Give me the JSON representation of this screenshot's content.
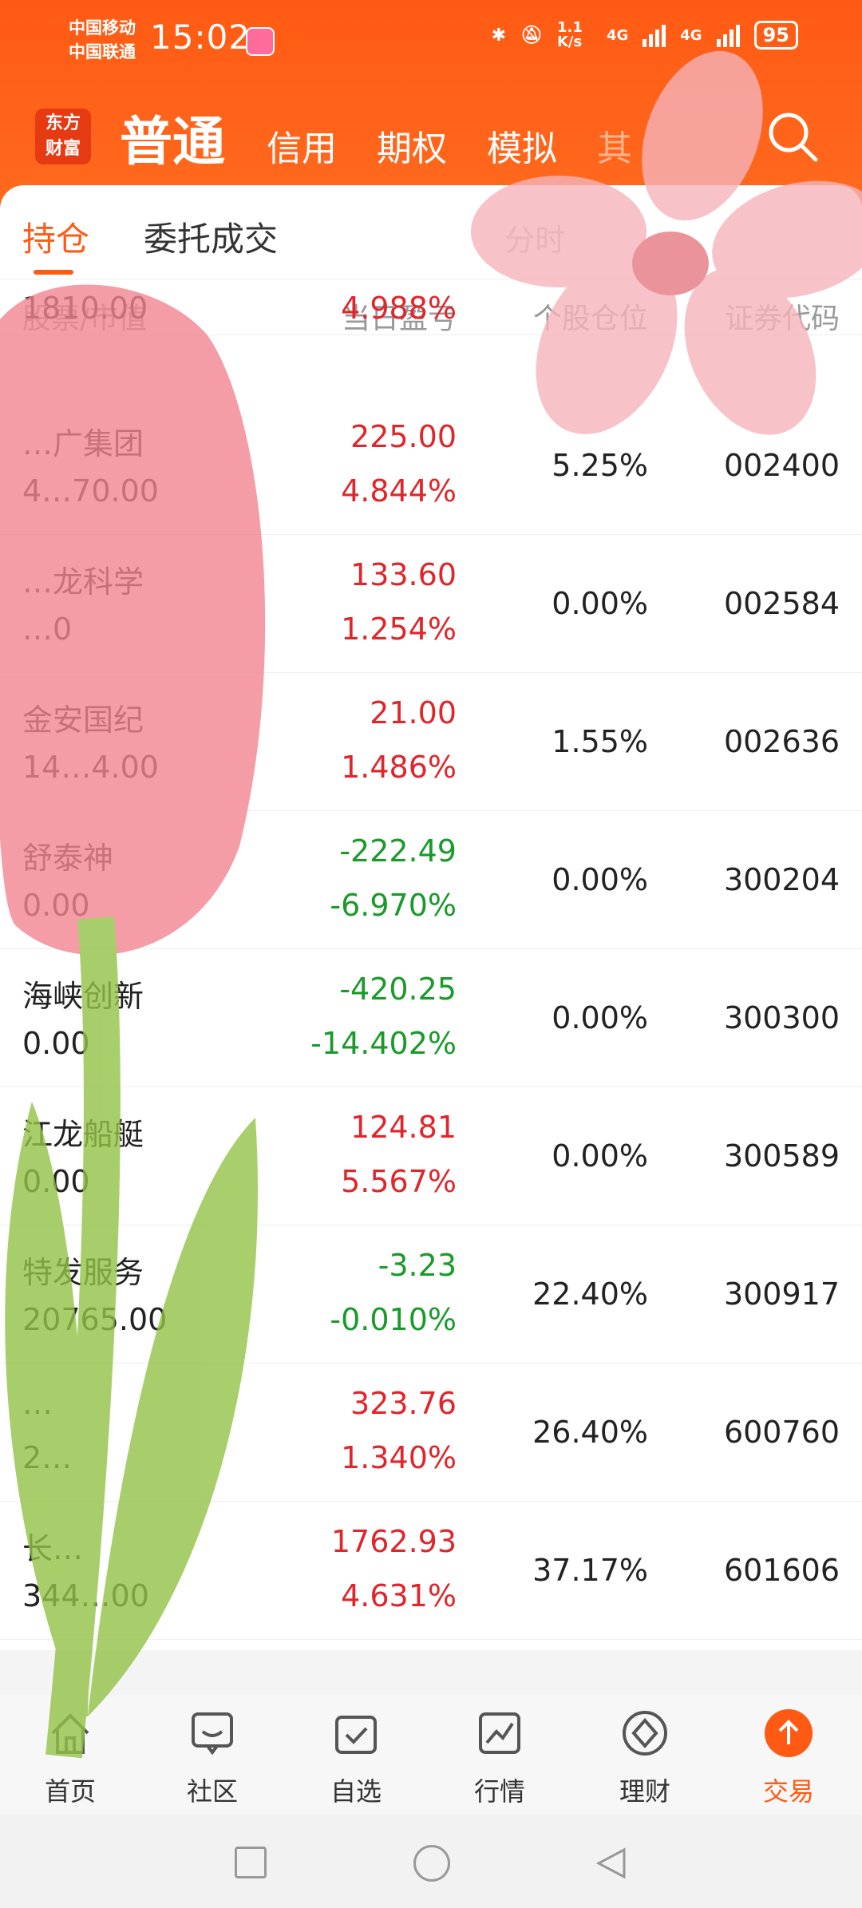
{
  "status": {
    "carrier1": "中国移动",
    "carrier2": "中国联通",
    "time": "15:02",
    "net_speed": "1.1 K/s",
    "net1": "4G",
    "net2": "4G",
    "battery": "95"
  },
  "appbar": {
    "logo_line1": "东方",
    "logo_line2": "财富",
    "tabs": [
      "普通",
      "信用",
      "期权",
      "模拟"
    ],
    "partial_tab": "其"
  },
  "subtabs": {
    "active": "持仓",
    "second": "委托成交",
    "faded": "分时"
  },
  "columns": {
    "name": "股票/市值",
    "pl": "当日盈亏",
    "position": "个股仓位",
    "code": "证券代码"
  },
  "top_partial": {
    "value": "1810.00",
    "pl_pct": "4.988%"
  },
  "rows": [
    {
      "name": "…广集团",
      "value": "4…70.00",
      "pl": "225.00",
      "pl_pct": "4.844%",
      "position": "5.25%",
      "code": "002400",
      "dir": "up"
    },
    {
      "name": "…龙科学",
      "value": "…0",
      "pl": "133.60",
      "pl_pct": "1.254%",
      "position": "0.00%",
      "code": "002584",
      "dir": "up"
    },
    {
      "name": "金安国纪",
      "value": "14…4.00",
      "pl": "21.00",
      "pl_pct": "1.486%",
      "position": "1.55%",
      "code": "002636",
      "dir": "up"
    },
    {
      "name": "舒泰神",
      "value": "0.00",
      "pl": "-222.49",
      "pl_pct": "-6.970%",
      "position": "0.00%",
      "code": "300204",
      "dir": "down"
    },
    {
      "name": "海峡创新",
      "value": "0.00",
      "pl": "-420.25",
      "pl_pct": "-14.402%",
      "position": "0.00%",
      "code": "300300",
      "dir": "down"
    },
    {
      "name": "江龙船艇",
      "value": "0.00",
      "pl": "124.81",
      "pl_pct": "5.567%",
      "position": "0.00%",
      "code": "300589",
      "dir": "up"
    },
    {
      "name": "特发服务",
      "value": "20765.00",
      "pl": "-3.23",
      "pl_pct": "-0.010%",
      "position": "22.40%",
      "code": "300917",
      "dir": "down"
    },
    {
      "name": "…",
      "value": "2…",
      "pl": "323.76",
      "pl_pct": "1.340%",
      "position": "26.40%",
      "code": "600760",
      "dir": "up"
    },
    {
      "name": "长…",
      "value": "344…00",
      "pl": "1762.93",
      "pl_pct": "4.631%",
      "position": "37.17%",
      "code": "601606",
      "dir": "up"
    }
  ],
  "bottomnav": [
    {
      "label": "首页",
      "icon": "home-icon"
    },
    {
      "label": "社区",
      "icon": "chat-icon"
    },
    {
      "label": "自选",
      "icon": "checkbox-icon"
    },
    {
      "label": "行情",
      "icon": "chart-icon"
    },
    {
      "label": "理财",
      "icon": "diamond-icon"
    },
    {
      "label": "交易",
      "icon": "up-arrow-icon"
    }
  ],
  "colors": {
    "brand": "#ff5a14",
    "up": "#e0262b",
    "down": "#1a9a2a"
  }
}
